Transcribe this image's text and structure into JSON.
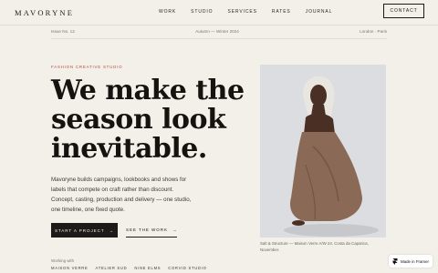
{
  "nav": {
    "logo": "MAVORYNE",
    "items": [
      "WORK",
      "STUDIO",
      "SERVICES",
      "RATES",
      "JOURNAL"
    ],
    "contact": "CONTACT"
  },
  "meta": {
    "issue": "Issue No. 12",
    "season": "Autumn — Winter 2024",
    "cities": "London · Paris"
  },
  "hero": {
    "eyebrow": "FASHION CREATIVE STUDIO",
    "headline": [
      "We make the",
      "season look",
      "inevitable."
    ],
    "body": "Mavoryne builds campaigns, lookbooks and shows for labels that compete on craft rather than discount. Concept, casting, production and delivery — one studio, one timeline, one fixed quote.",
    "primary_cta": "START A PROJECT",
    "primary_arrow": "→",
    "secondary_cta": "SEE THE WORK",
    "secondary_arrow": "→",
    "working_with": "Working with",
    "clients": [
      "MAISON VERRE",
      "ATELIER SUD",
      "NINE ELMS",
      "CORVID STUDIO"
    ]
  },
  "photo": {
    "caption": "Salt & Structure — Maison Verre A/W 24. Costa da Caparica, November."
  },
  "badge": {
    "label": "Made in Framer"
  },
  "colors": {
    "background": "#f3f0ea",
    "accent": "#b74a3a",
    "ink": "#1d1b19"
  }
}
